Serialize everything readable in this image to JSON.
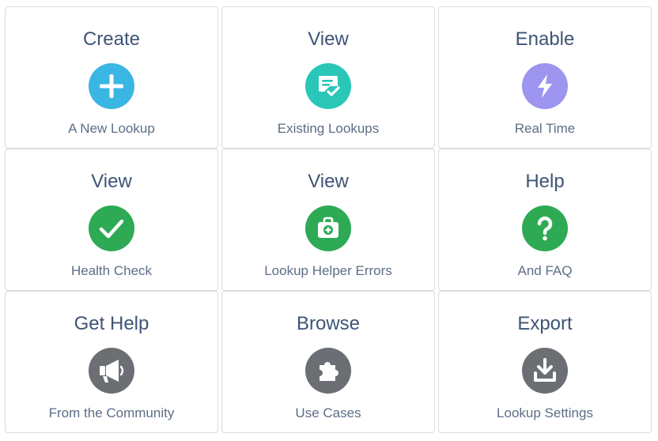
{
  "tiles": [
    {
      "title": "Create",
      "subtitle": "A New Lookup",
      "icon": "add-icon",
      "color": "#3ab6e3"
    },
    {
      "title": "View",
      "subtitle": "Existing Lookups",
      "icon": "task-check-icon",
      "color": "#2ac7b8"
    },
    {
      "title": "Enable",
      "subtitle": "Real Time",
      "icon": "lightning-icon",
      "color": "#9d95ef"
    },
    {
      "title": "View",
      "subtitle": "Health Check",
      "icon": "check-icon",
      "color": "#2eaa55"
    },
    {
      "title": "View",
      "subtitle": "Lookup Helper Errors",
      "icon": "first-aid-icon",
      "color": "#2eaa55"
    },
    {
      "title": "Help",
      "subtitle": "And FAQ",
      "icon": "question-icon",
      "color": "#2eaa55"
    },
    {
      "title": "Get Help",
      "subtitle": "From the Community",
      "icon": "megaphone-icon",
      "color": "#6b6f73"
    },
    {
      "title": "Browse",
      "subtitle": "Use Cases",
      "icon": "puzzle-icon",
      "color": "#6b6f73"
    },
    {
      "title": "Export",
      "subtitle": "Lookup Settings",
      "icon": "download-icon",
      "color": "#6b6f73"
    }
  ]
}
